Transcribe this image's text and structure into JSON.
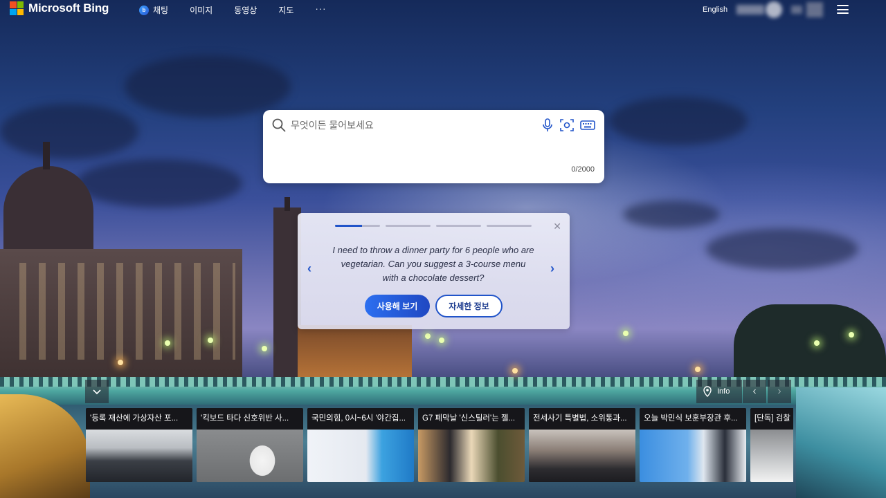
{
  "brand": {
    "name": "Microsoft Bing"
  },
  "nav": {
    "items": [
      {
        "label": "채팅",
        "icon": "copilot-chat-icon"
      },
      {
        "label": "이미지"
      },
      {
        "label": "동영상"
      },
      {
        "label": "지도"
      },
      {
        "label": "···",
        "icon": "more-icon"
      }
    ]
  },
  "header": {
    "language_link": "English"
  },
  "search": {
    "placeholder": "무엇이든 물어보세요",
    "value": "",
    "char_count": "0/2000"
  },
  "prompt_card": {
    "progress": {
      "segments": 4,
      "active_index": 0,
      "active_fill": 0.6
    },
    "text": "I need to throw a dinner party for 6 people who are vegetarian. Can you suggest a 3-course menu with a chocolate dessert?",
    "try_button": "사용해 보기",
    "learn_more_button": "자세한 정보"
  },
  "image_controls": {
    "info_label": "Info"
  },
  "news": [
    {
      "title": "'등록 재산에 가상자산 포...",
      "thumb": "meeting-room"
    },
    {
      "title": "'킥보드 타다 신호위반 사...",
      "thumb": "scooter"
    },
    {
      "title": "국민의힘, 0시~6시 '야간집...",
      "thumb": "politicians"
    },
    {
      "title": "G7 폐막날 '신스틸러'는 젤...",
      "thumb": "summit"
    },
    {
      "title": "전세사기 특별법, 소위통과...",
      "thumb": "committee"
    },
    {
      "title": "오늘 박민식 보훈부장관 후...",
      "thumb": "minister"
    },
    {
      "title": "[단독] 검찰",
      "thumb": "partial"
    }
  ],
  "colors": {
    "accent": "#2154c9",
    "ms_red": "#f25022",
    "ms_green": "#7fba00",
    "ms_blue": "#00a4ef",
    "ms_yellow": "#ffb900"
  }
}
